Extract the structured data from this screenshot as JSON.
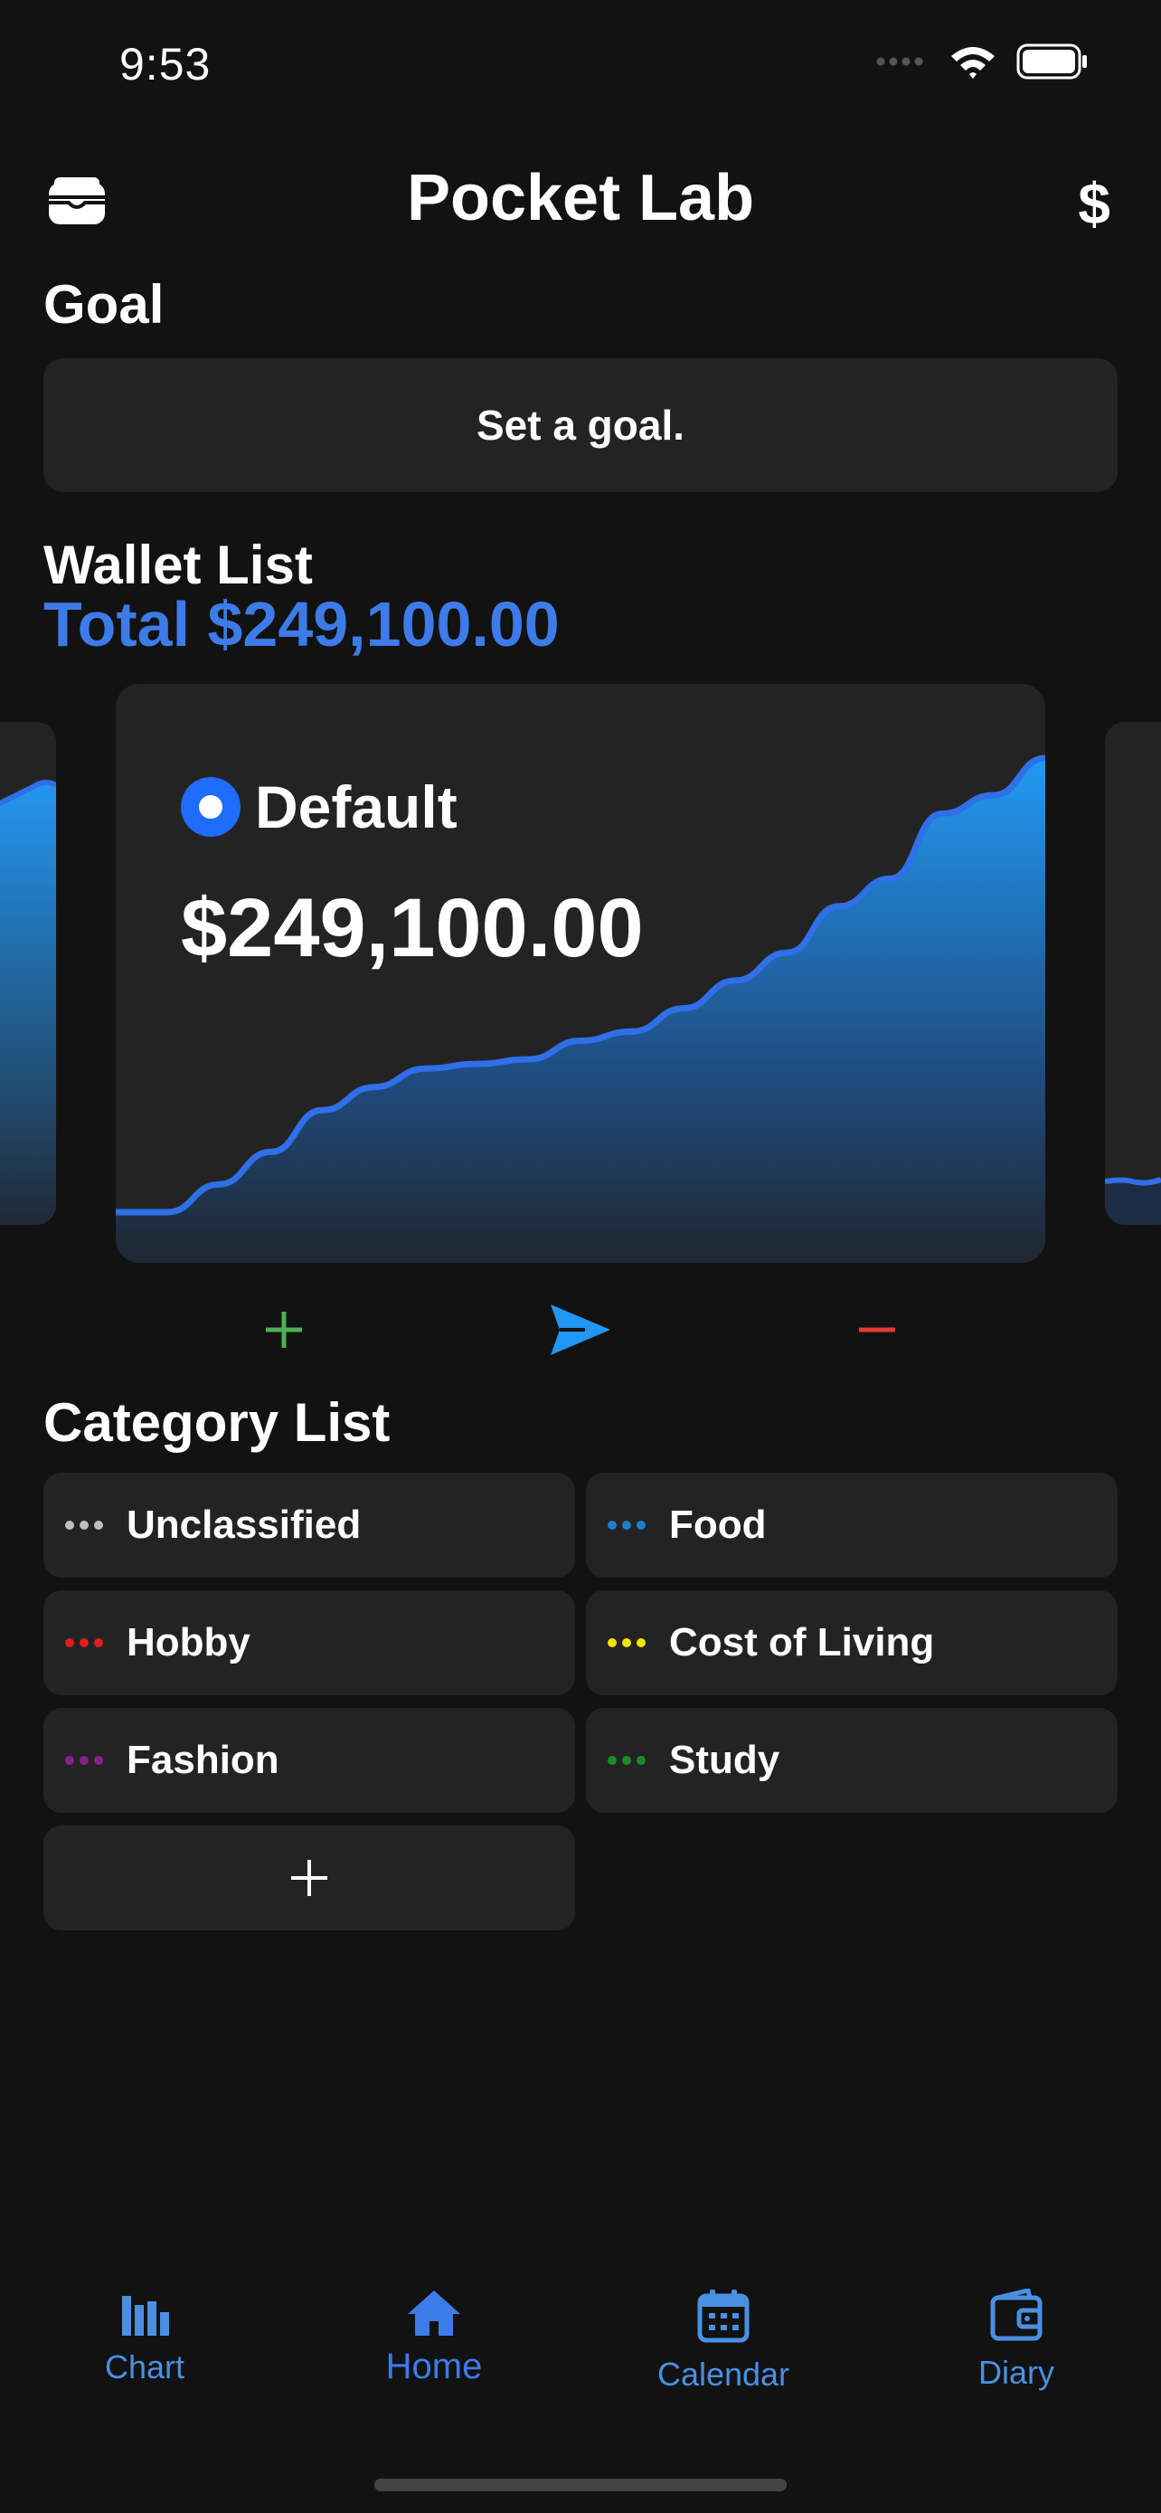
{
  "status_bar": {
    "time": "9:53",
    "icons": [
      "signal-icon",
      "wifi-icon",
      "battery-icon"
    ]
  },
  "nav": {
    "title": "Pocket Lab",
    "left_icon": "wallet-icon",
    "right_symbol": "$"
  },
  "goal": {
    "title": "Goal",
    "placeholder": "Set a goal."
  },
  "wallets": {
    "title": "Wallet List",
    "total": "Total $249,100.00",
    "cards": [
      {
        "name": "Default",
        "amount": "$249,100.00",
        "trend_values": [
          2,
          2,
          8,
          15,
          24,
          29,
          33,
          34,
          35,
          39,
          41,
          46,
          52,
          58,
          68,
          74,
          88,
          92,
          100
        ]
      }
    ]
  },
  "actions": {
    "add": "+",
    "send": "send-icon",
    "subtract": "−"
  },
  "categories": {
    "title": "Category List",
    "items": [
      {
        "label": "Unclassified",
        "color": "#bfbfbf"
      },
      {
        "label": "Food",
        "color": "#1e7fc9"
      },
      {
        "label": "Hobby",
        "color": "#e01e1e"
      },
      {
        "label": "Cost of Living",
        "color": "#f2e600"
      },
      {
        "label": "Fashion",
        "color": "#8a1f8a"
      },
      {
        "label": "Study",
        "color": "#1e8a2a"
      }
    ],
    "add_label": "+"
  },
  "tab_bar": {
    "tabs": [
      {
        "label": "Chart",
        "icon": "chart-icon"
      },
      {
        "label": "Home",
        "icon": "home-icon",
        "active": true
      },
      {
        "label": "Calendar",
        "icon": "calendar-icon"
      },
      {
        "label": "Diary",
        "icon": "diary-icon"
      }
    ]
  },
  "colors": {
    "background": "#121212",
    "card": "#232323",
    "accent": "#3d7be8",
    "add_green": "#4caf50",
    "subtract_red": "#e53935",
    "send_blue": "#2196f3"
  }
}
